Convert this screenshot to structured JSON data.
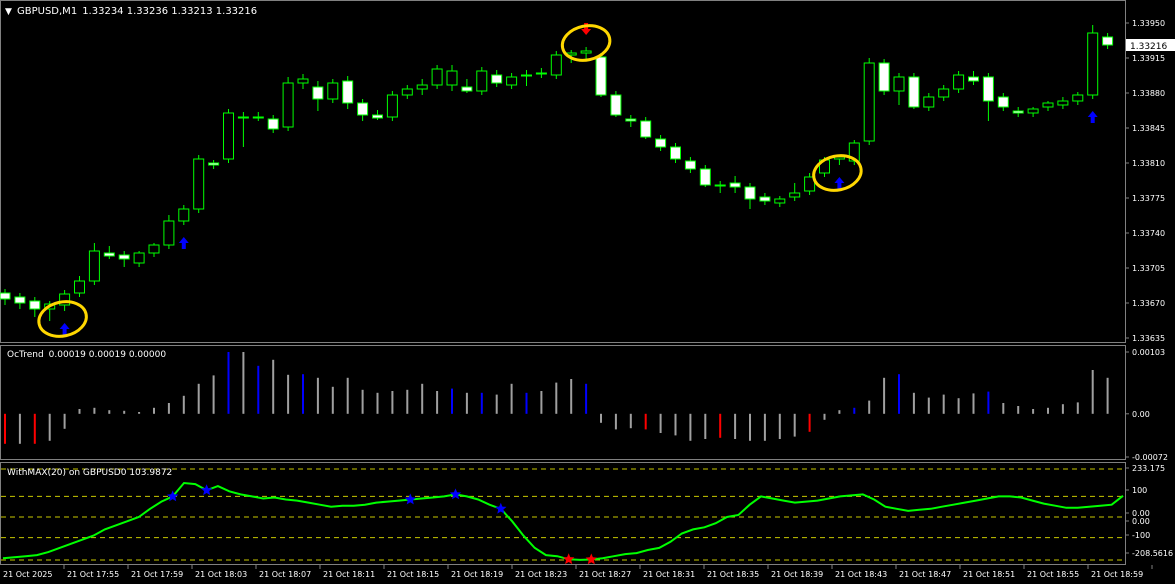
{
  "main_panel": {
    "symbol_label": "GBPUSD,M1",
    "ohlc": "1.33234 1.33236 1.33213 1.33216",
    "dropdown_icon": "triangle-down-icon",
    "price_ticks": [
      "1.33950",
      "1.33915",
      "1.33880",
      "1.33845",
      "1.33810",
      "1.33775",
      "1.33740",
      "1.33705",
      "1.33670",
      "1.33635"
    ],
    "current_price": "1.33216",
    "bull_color": "#00ff00",
    "bear_color": "#ffffff",
    "buy_arrow_color": "#0000ff",
    "sell_arrow_color": "#ff0000",
    "highlight_color": "#ffd700"
  },
  "octrend_panel": {
    "label": "OcTrend",
    "values": "0.00019 0.00019 0.00000",
    "ticks": [
      "0.00103",
      "0.00",
      "-0.00072"
    ],
    "colors": {
      "neutral": "#a0a0a0",
      "up": "#0000ff",
      "down": "#ff0000"
    }
  },
  "wpr_panel": {
    "label": "WithMAX(20) on GBPUSD0 103.9872",
    "ticks": [
      "233.175",
      "100",
      "0.00",
      "0.00",
      "-100",
      "-208.5616"
    ],
    "line_color": "#00ff00",
    "upper_star_color": "#0000ff",
    "lower_star_color": "#ff0000",
    "level_color": "#c8c800"
  },
  "time_axis": [
    "21 Oct 2025",
    "21 Oct 17:55",
    "21 Oct 17:59",
    "21 Oct 18:03",
    "21 Oct 18:07",
    "21 Oct 18:11",
    "21 Oct 18:15",
    "21 Oct 18:19",
    "21 Oct 18:23",
    "21 Oct 18:27",
    "21 Oct 18:31",
    "21 Oct 18:35",
    "21 Oct 18:39",
    "21 Oct 18:43",
    "21 Oct 18:47",
    "21 Oct 18:51",
    "21 Oct 18:55",
    "21 Oct 18:59"
  ],
  "chart_data": {
    "type": "candlestick",
    "candles_ohlc": [
      [
        1.3368,
        1.33684,
        1.33668,
        1.33674
      ],
      [
        1.33676,
        1.3368,
        1.33664,
        1.3367
      ],
      [
        1.33672,
        1.33676,
        1.33656,
        1.33664
      ],
      [
        1.33664,
        1.33672,
        1.33652,
        1.33669
      ],
      [
        1.33668,
        1.33683,
        1.33662,
        1.33679
      ],
      [
        1.3368,
        1.33697,
        1.33676,
        1.33692
      ],
      [
        1.33692,
        1.3373,
        1.33688,
        1.33722
      ],
      [
        1.3372,
        1.33727,
        1.33714,
        1.33717
      ],
      [
        1.33718,
        1.33722,
        1.33706,
        1.33714
      ],
      [
        1.3371,
        1.33722,
        1.33706,
        1.3372
      ],
      [
        1.3372,
        1.3373,
        1.33716,
        1.33728
      ],
      [
        1.33728,
        1.33758,
        1.33724,
        1.33752
      ],
      [
        1.33752,
        1.33768,
        1.33748,
        1.33764
      ],
      [
        1.33764,
        1.33818,
        1.3376,
        1.33814
      ],
      [
        1.3381,
        1.33813,
        1.33804,
        1.33808
      ],
      [
        1.33814,
        1.33864,
        1.3381,
        1.3386
      ],
      [
        1.33856,
        1.33861,
        1.33826,
        1.33856
      ],
      [
        1.33856,
        1.33861,
        1.33852,
        1.33856
      ],
      [
        1.33854,
        1.33858,
        1.3384,
        1.33844
      ],
      [
        1.33846,
        1.33896,
        1.33842,
        1.3389
      ],
      [
        1.3389,
        1.33899,
        1.33884,
        1.33894
      ],
      [
        1.33886,
        1.33892,
        1.33862,
        1.33874
      ],
      [
        1.33874,
        1.33894,
        1.3387,
        1.3389
      ],
      [
        1.33892,
        1.33897,
        1.33864,
        1.3387
      ],
      [
        1.3387,
        1.33874,
        1.33852,
        1.33858
      ],
      [
        1.33858,
        1.33863,
        1.33853,
        1.33855
      ],
      [
        1.33856,
        1.33882,
        1.33852,
        1.33878
      ],
      [
        1.33878,
        1.33888,
        1.33874,
        1.33884
      ],
      [
        1.33884,
        1.33894,
        1.33878,
        1.33888
      ],
      [
        1.33888,
        1.33908,
        1.33884,
        1.33904
      ],
      [
        1.33888,
        1.33908,
        1.33882,
        1.33902
      ],
      [
        1.33886,
        1.33894,
        1.3388,
        1.33882
      ],
      [
        1.33882,
        1.33906,
        1.33878,
        1.33902
      ],
      [
        1.33898,
        1.33903,
        1.33886,
        1.3389
      ],
      [
        1.33888,
        1.339,
        1.33884,
        1.33896
      ],
      [
        1.33898,
        1.33903,
        1.33887,
        1.33898
      ],
      [
        1.339,
        1.33905,
        1.33895,
        1.339
      ],
      [
        1.33898,
        1.33922,
        1.33894,
        1.33918
      ],
      [
        1.33918,
        1.33923,
        1.3391,
        1.3392
      ],
      [
        1.3392,
        1.33926,
        1.33914,
        1.33922
      ],
      [
        1.33916,
        1.3392,
        1.33876,
        1.33878
      ],
      [
        1.33878,
        1.33882,
        1.33856,
        1.33858
      ],
      [
        1.33854,
        1.33858,
        1.33846,
        1.33852
      ],
      [
        1.33852,
        1.33856,
        1.33834,
        1.33836
      ],
      [
        1.33834,
        1.33838,
        1.33822,
        1.33826
      ],
      [
        1.33826,
        1.3383,
        1.3381,
        1.33814
      ],
      [
        1.33812,
        1.33816,
        1.338,
        1.33804
      ],
      [
        1.33804,
        1.33808,
        1.33786,
        1.33788
      ],
      [
        1.33788,
        1.33792,
        1.3378,
        1.33788
      ],
      [
        1.3379,
        1.33797,
        1.3378,
        1.33786
      ],
      [
        1.33786,
        1.3379,
        1.33764,
        1.33774
      ],
      [
        1.33776,
        1.3378,
        1.33768,
        1.33772
      ],
      [
        1.3377,
        1.33777,
        1.33766,
        1.33774
      ],
      [
        1.33776,
        1.3379,
        1.33772,
        1.3378
      ],
      [
        1.33782,
        1.338,
        1.33778,
        1.33796
      ],
      [
        1.338,
        1.33816,
        1.33796,
        1.33813
      ],
      [
        1.33814,
        1.33818,
        1.33808,
        1.33816
      ],
      [
        1.33812,
        1.33833,
        1.33808,
        1.3383
      ],
      [
        1.33832,
        1.33915,
        1.33828,
        1.3391
      ],
      [
        1.3391,
        1.33914,
        1.33878,
        1.33882
      ],
      [
        1.33882,
        1.339,
        1.33868,
        1.33896
      ],
      [
        1.33896,
        1.339,
        1.33864,
        1.33866
      ],
      [
        1.33866,
        1.3388,
        1.33862,
        1.33876
      ],
      [
        1.33876,
        1.33888,
        1.33872,
        1.33884
      ],
      [
        1.33884,
        1.33902,
        1.3388,
        1.33898
      ],
      [
        1.33896,
        1.33902,
        1.33888,
        1.33892
      ],
      [
        1.33896,
        1.339,
        1.33852,
        1.33872
      ],
      [
        1.33876,
        1.3388,
        1.33862,
        1.33866
      ],
      [
        1.33862,
        1.33866,
        1.33856,
        1.3386
      ],
      [
        1.3386,
        1.33866,
        1.33856,
        1.33864
      ],
      [
        1.33866,
        1.33872,
        1.33862,
        1.3387
      ],
      [
        1.33868,
        1.33876,
        1.33864,
        1.33872
      ],
      [
        1.33872,
        1.33881,
        1.33868,
        1.33878
      ],
      [
        1.33878,
        1.33948,
        1.33874,
        1.3394
      ],
      [
        1.33936,
        1.3394,
        1.33924,
        1.33928
      ]
    ],
    "buy_arrows_at_candle": [
      4,
      12,
      56,
      73
    ],
    "sell_arrows_at_candle": [
      39
    ],
    "highlighted_candles": [
      4,
      39,
      56
    ],
    "octrend_histogram": {
      "values": [
        -0.0005,
        -0.0005,
        -0.0005,
        -0.00045,
        -0.00025,
        8e-05,
        0.0001,
        6e-05,
        5e-05,
        3e-05,
        0.0001,
        0.00018,
        0.0003,
        0.0005,
        0.00064,
        0.00103,
        0.00103,
        0.0008,
        0.0009,
        0.00065,
        0.00066,
        0.0006,
        0.00045,
        0.0006,
        0.0004,
        0.00035,
        0.00038,
        0.0004,
        0.0005,
        0.00038,
        0.00042,
        0.00035,
        0.00035,
        0.00032,
        0.0005,
        0.00035,
        0.00038,
        0.00052,
        0.00058,
        0.0005,
        -0.00015,
        -0.00026,
        -0.00024,
        -0.00026,
        -0.00032,
        -0.00036,
        -0.00045,
        -0.00042,
        -0.0004,
        -0.00042,
        -0.00045,
        -0.00045,
        -0.00042,
        -0.00038,
        -0.0003,
        -0.0001,
        6e-05,
        0.0001,
        0.00022,
        0.0006,
        0.00066,
        0.00035,
        0.00027,
        0.00032,
        0.00026,
        0.00034,
        0.00037,
        0.00018,
        0.00013,
        8e-05,
        0.0001,
        0.00016,
        0.00019,
        0.00073,
        0.0006
      ],
      "colors": [
        "d",
        "n",
        "d",
        "n",
        "n",
        "n",
        "n",
        "n",
        "n",
        "n",
        "n",
        "n",
        "n",
        "n",
        "n",
        "u",
        "n",
        "u",
        "n",
        "n",
        "u",
        "n",
        "n",
        "n",
        "n",
        "n",
        "n",
        "n",
        "n",
        "n",
        "u",
        "n",
        "u",
        "n",
        "n",
        "u",
        "n",
        "n",
        "n",
        "u",
        "n",
        "n",
        "n",
        "d",
        "n",
        "n",
        "n",
        "n",
        "d",
        "n",
        "n",
        "n",
        "n",
        "n",
        "d",
        "n",
        "n",
        "u",
        "n",
        "n",
        "u",
        "n",
        "n",
        "n",
        "n",
        "n",
        "u",
        "n",
        "n",
        "n",
        "n",
        "n",
        "n",
        "n",
        "n"
      ]
    },
    "withmax_line": [
      -200,
      -195,
      -190,
      -185,
      -170,
      -150,
      -130,
      -110,
      -90,
      -60,
      -40,
      -20,
      0,
      40,
      75,
      100,
      165,
      160,
      130,
      150,
      125,
      110,
      100,
      90,
      95,
      85,
      80,
      70,
      60,
      50,
      55,
      55,
      60,
      70,
      75,
      80,
      85,
      90,
      95,
      100,
      110,
      100,
      85,
      60,
      40,
      -20,
      -90,
      -150,
      -185,
      -190,
      -205,
      -208,
      -206,
      -200,
      -190,
      -180,
      -175,
      -160,
      -150,
      -120,
      -80,
      -60,
      -50,
      -30,
      0,
      10,
      60,
      100,
      90,
      80,
      70,
      75,
      80,
      90,
      100,
      105,
      110,
      85,
      50,
      40,
      30,
      35,
      40,
      50,
      60,
      70,
      80,
      90,
      100,
      100,
      95,
      80,
      65,
      55,
      45,
      45,
      50,
      55,
      60,
      103
    ],
    "upper_stars_at_point": [
      15,
      18,
      36,
      40,
      44
    ],
    "lower_stars_at_point": [
      50,
      52
    ],
    "levels": [
      100,
      0,
      -100
    ]
  }
}
